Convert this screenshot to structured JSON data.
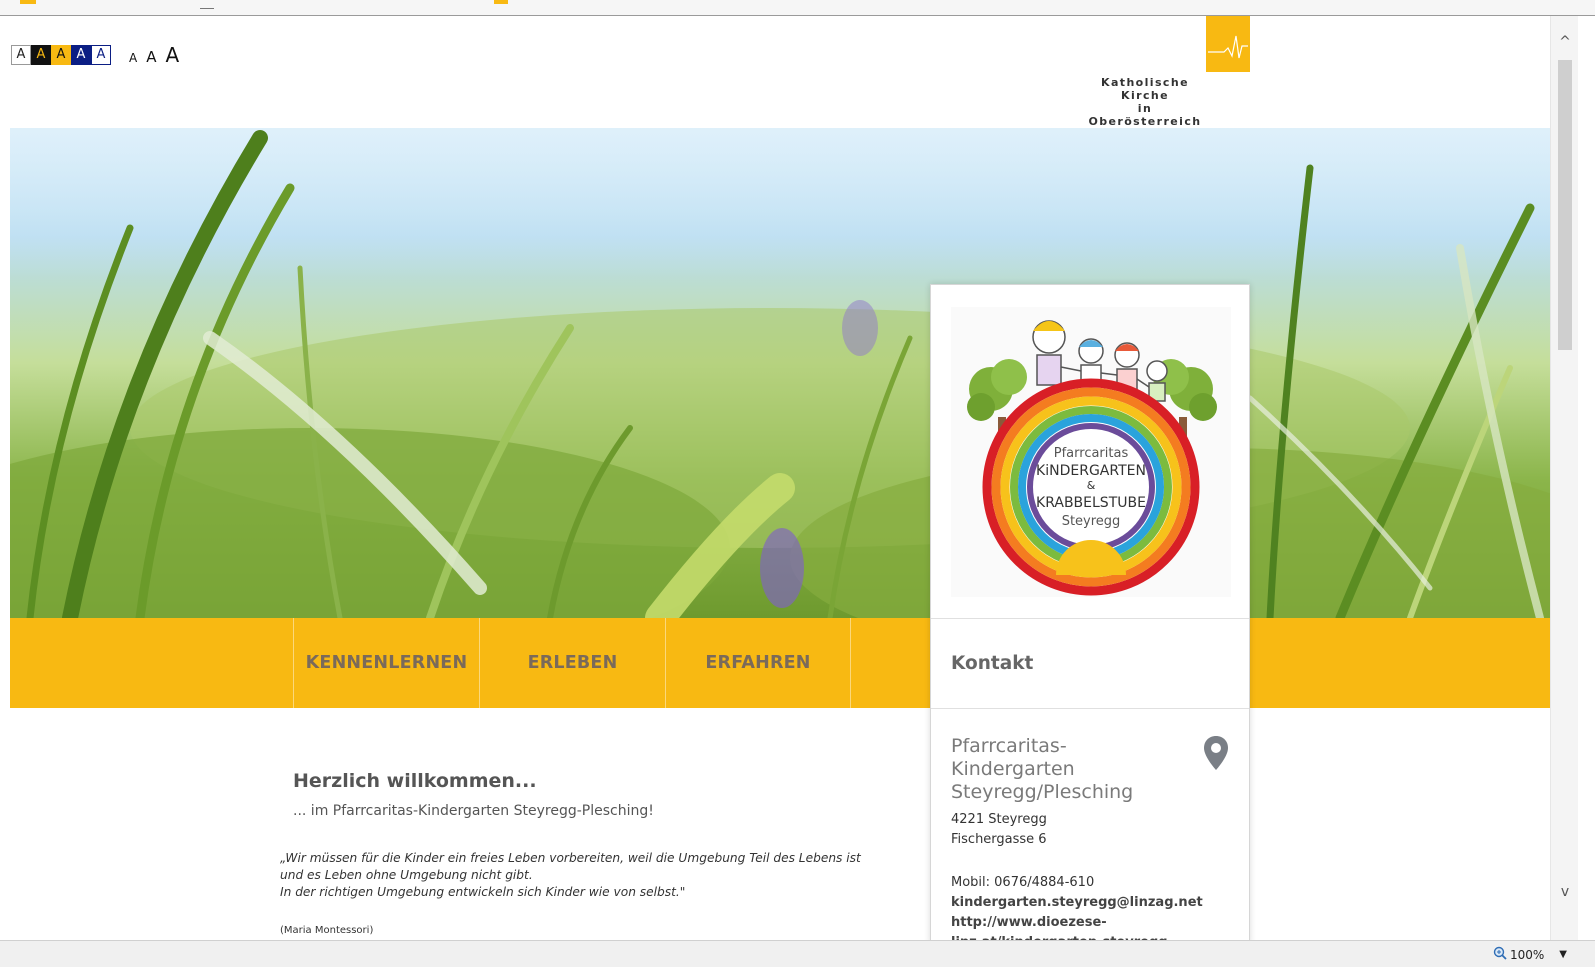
{
  "accessibility": {
    "contrast_letters": [
      "A",
      "A",
      "A",
      "A",
      "A"
    ],
    "size_letters": [
      "A",
      "A",
      "A"
    ]
  },
  "brand": {
    "line1": "Katholische Kirche",
    "line2": "in Oberösterreich",
    "color": "#f8b912"
  },
  "logo": {
    "line1": "Pfarrcaritas",
    "line2": "KiNDERGARTEN",
    "line3": "&",
    "line4": "KRABBELSTUBE",
    "line5": "Steyregg"
  },
  "nav": {
    "items": [
      "KENNENLERNEN",
      "ERLEBEN",
      "ERFAHREN"
    ]
  },
  "contact": {
    "heading": "Kontakt",
    "org_line1": "Pfarrcaritas-Kindergarten",
    "org_line2": "Steyregg/Plesching",
    "addr_line1": "4221 Steyregg",
    "addr_line2": "Fischergasse 6",
    "phone": "Mobil: 0676/4884-610",
    "email": "kindergarten.steyregg@linzag.net",
    "url": "http://www.dioezese-linz.at/kindergarten-steyregg"
  },
  "main": {
    "welcome": "Herzlich willkommen...",
    "subtitle": "... im Pfarrcaritas-Kindergarten Steyregg-Plesching!",
    "quote_line1": "„Wir müssen für die Kinder ein freies Leben vorbereiten, weil die Umgebung Teil des Lebens ist",
    "quote_line2": "und es Leben ohne Umgebung nicht gibt.",
    "quote_line3": "In der richtigen Umgebung entwickeln sich Kinder wie von selbst.\"",
    "author": "(Maria Montessori)"
  },
  "statusbar": {
    "zoom": "100%"
  },
  "colors": {
    "accent": "#f8b912",
    "nav_text": "#7a6a5a",
    "card_text": "#7a7a7a",
    "contrast_blue": "#0b1e84"
  }
}
